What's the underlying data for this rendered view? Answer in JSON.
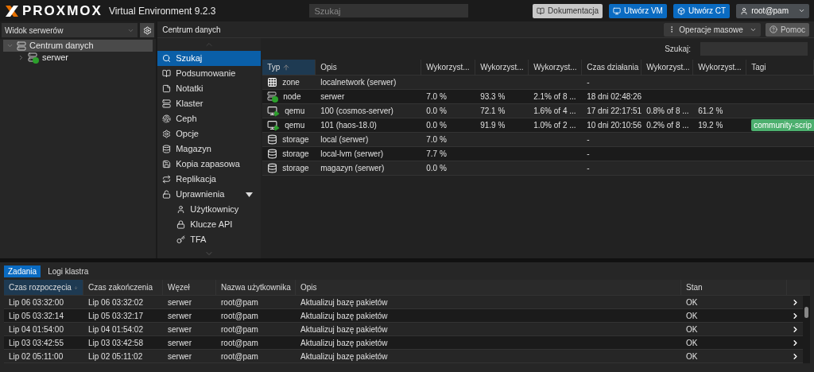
{
  "header": {
    "brand": "PROXMOX",
    "product": "Virtual Environment 9.2.3",
    "search": {
      "placeholder": "Szukaj"
    },
    "buttons": [
      {
        "label": "Dokumentacja",
        "kind": "docs"
      },
      {
        "label": "Utwórz VM",
        "kind": "vm"
      },
      {
        "label": "Utwórz CT",
        "kind": "ct"
      },
      {
        "label": "root@pam",
        "kind": "user"
      }
    ]
  },
  "sidebar": {
    "view": "Widok serwerów",
    "tree": [
      {
        "label": "Centrum danych",
        "selected": true,
        "expanded": true,
        "children": [
          {
            "label": "serwer",
            "selected": false,
            "expanded": false
          }
        ]
      }
    ]
  },
  "content": {
    "title": "Centrum danych",
    "toolbar": [
      {
        "label": "Operacje masowe",
        "kind": "menu"
      },
      {
        "label": "Pomoc",
        "kind": "help"
      }
    ],
    "nav": [
      {
        "label": "Szukaj",
        "selected": true
      },
      {
        "label": "Podsumowanie",
        "selected": false
      },
      {
        "label": "Notatki",
        "selected": false
      },
      {
        "label": "Klaster",
        "selected": false
      },
      {
        "label": "Ceph",
        "selected": false
      },
      {
        "label": "Opcje",
        "selected": false
      },
      {
        "label": "Magazyn",
        "selected": false
      },
      {
        "label": "Kopia zapasowa",
        "selected": false
      },
      {
        "label": "Replikacja",
        "selected": false
      },
      {
        "label": "Uprawnienia",
        "selected": false,
        "expanded": true,
        "children": [
          {
            "label": "Użytkownicy",
            "selected": false
          },
          {
            "label": "Klucze API",
            "selected": false
          },
          {
            "label": "TFA",
            "selected": false
          }
        ]
      }
    ],
    "search_label": "Szukaj:",
    "table": {
      "columns": [
        {
          "label": "Typ",
          "sorted": true
        },
        {
          "label": "Opis"
        },
        {
          "label": "Wykorzyst..."
        },
        {
          "label": "Wykorzyst..."
        },
        {
          "label": "Wykorzyst..."
        },
        {
          "label": "Czas działania"
        },
        {
          "label": "Wykorzyst..."
        },
        {
          "label": "Wykorzyst..."
        },
        {
          "label": "Tagi"
        }
      ],
      "rows": [
        {
          "kind": "zone",
          "cells": [
            "zone",
            "localnetwork (serwer)",
            "",
            "",
            "",
            "-",
            "",
            ""
          ],
          "tags": []
        },
        {
          "kind": "node",
          "cells": [
            "node",
            "serwer",
            "7.0 %",
            "93.3 %",
            "2.1% of 8 ...",
            "18 dni 02:48:26",
            "",
            ""
          ],
          "tags": []
        },
        {
          "kind": "qemu",
          "cells": [
            "qemu",
            "100 (cosmos-server)",
            "0.0 %",
            "72.1 %",
            "1.6% of 4 ...",
            "17 dni 22:17:51",
            "0.8% of 8 ...",
            "61.2 %"
          ],
          "tags": []
        },
        {
          "kind": "qemu",
          "cells": [
            "qemu",
            "101 (haos-18.0)",
            "0.0 %",
            "91.9 %",
            "1.0% of 2 ...",
            "10 dni 20:10:56",
            "0.2% of 8 ...",
            "19.2 %"
          ],
          "tags": [
            {
              "label": "community-scrip",
              "color": "#4caf6e"
            }
          ]
        },
        {
          "kind": "storage",
          "cells": [
            "storage",
            "local (serwer)",
            "7.0 %",
            "",
            "",
            "-",
            "",
            ""
          ],
          "tags": []
        },
        {
          "kind": "storage",
          "cells": [
            "storage",
            "local-lvm (serwer)",
            "7.7 %",
            "",
            "",
            "-",
            "",
            ""
          ],
          "tags": []
        },
        {
          "kind": "storage",
          "cells": [
            "storage",
            "magazyn (serwer)",
            "0.0 %",
            "",
            "",
            "-",
            "",
            ""
          ],
          "tags": []
        }
      ]
    }
  },
  "log": {
    "tabs": [
      {
        "label": "Zadania",
        "selected": true
      },
      {
        "label": "Logi klastra",
        "selected": false
      }
    ],
    "columns": [
      {
        "label": "Czas rozpoczęcia",
        "sorted": true
      },
      {
        "label": "Czas zakończenia"
      },
      {
        "label": "Węzeł"
      },
      {
        "label": "Nazwa użytkownika"
      },
      {
        "label": "Opis"
      },
      {
        "label": "Stan"
      }
    ],
    "rows": [
      [
        "Lip 06 03:32:00",
        "Lip 06 03:32:02",
        "serwer",
        "root@pam",
        "Aktualizuj bazę pakietów",
        "OK"
      ],
      [
        "Lip 05 03:32:14",
        "Lip 05 03:32:17",
        "serwer",
        "root@pam",
        "Aktualizuj bazę pakietów",
        "OK"
      ],
      [
        "Lip 04 01:54:00",
        "Lip 04 01:54:02",
        "serwer",
        "root@pam",
        "Aktualizuj bazę pakietów",
        "OK"
      ],
      [
        "Lip 03 03:42:55",
        "Lip 03 03:42:58",
        "serwer",
        "root@pam",
        "Aktualizuj bazę pakietów",
        "OK"
      ],
      [
        "Lip 02 05:11:00",
        "Lip 02 05:11:02",
        "serwer",
        "root@pam",
        "Aktualizuj bazę pakietów",
        "OK"
      ]
    ]
  }
}
